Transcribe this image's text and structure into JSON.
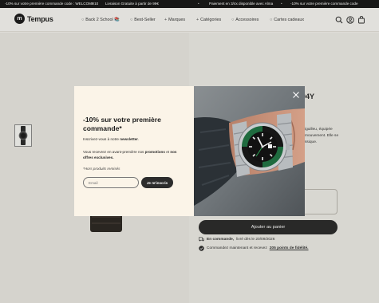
{
  "announcement": {
    "items": [
      "-10% sur votre première commande code : WELCOME10",
      "Livraison Gratuite à partir de 99€",
      "Paiement en 3/4x disponible avec Alma",
      "-10% sur votre première commande code"
    ]
  },
  "header": {
    "brand": "Tempus",
    "nav": [
      {
        "label": "Back 2 School 📚"
      },
      {
        "label": "Best-Seller"
      },
      {
        "label": "Marques"
      },
      {
        "label": "Catégories"
      },
      {
        "label": "Accessoires"
      },
      {
        "label": "Cartes cadeaux"
      }
    ],
    "icons": [
      "search-icon",
      "account-icon",
      "cart-icon"
    ]
  },
  "product": {
    "title_peek": "04Y",
    "desc_peek": [
      "iguilleu, équipée",
      "mouvement. Elle se",
      "ssique."
    ],
    "add_to_cart": "Ajouter au panier",
    "delivery": {
      "label": "En commande,",
      "text": "livré dès le 20/09/2026"
    },
    "points": {
      "text": "Commandez maintenant et recevez",
      "link": "205 points de fidélité."
    }
  },
  "modal": {
    "title": "-10% sur votre première commande*",
    "subtitle_text": "Inscrivez-vous à notre",
    "subtitle_bold": "newsletter",
    "subtitle_end": ".",
    "desc_text": "Vous recevrez en avant-première nos",
    "desc_bold1": "promotions",
    "desc_and": "et",
    "desc_bold2": "nos offres exclusives.",
    "note": "*Hors produits remisés",
    "email_placeholder": "Email",
    "submit": "Je m'inscris"
  },
  "colors": {
    "dark": "#2a2a2a",
    "modal_bg": "#fbf4e8",
    "page_bg": "#eeece7",
    "bezel_green": "#1f6b3f"
  }
}
